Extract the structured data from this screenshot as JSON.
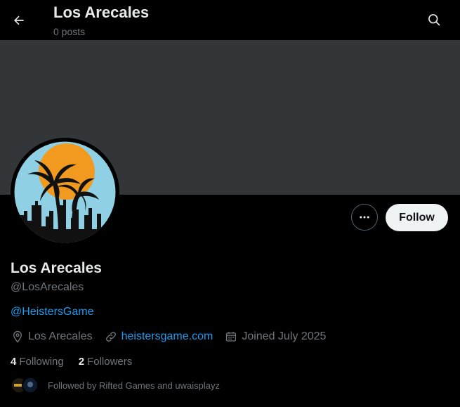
{
  "header": {
    "title": "Los Arecales",
    "subtitle": "0 posts"
  },
  "profile": {
    "name": "Los Arecales",
    "handle": "@LosArecales",
    "bio_link": "@HeistersGame",
    "location": "Los Arecales",
    "website": "heistersgame.com",
    "joined": "Joined July 2025",
    "following_count": "4",
    "following_label": "Following",
    "followers_count": "2",
    "followers_label": "Followers",
    "followed_by": "Followed by Rifted Games and uwaisplayz"
  },
  "actions": {
    "follow_label": "Follow"
  },
  "colors": {
    "accent": "#1d9bf0",
    "banner": "#333639",
    "background": "#000000"
  }
}
